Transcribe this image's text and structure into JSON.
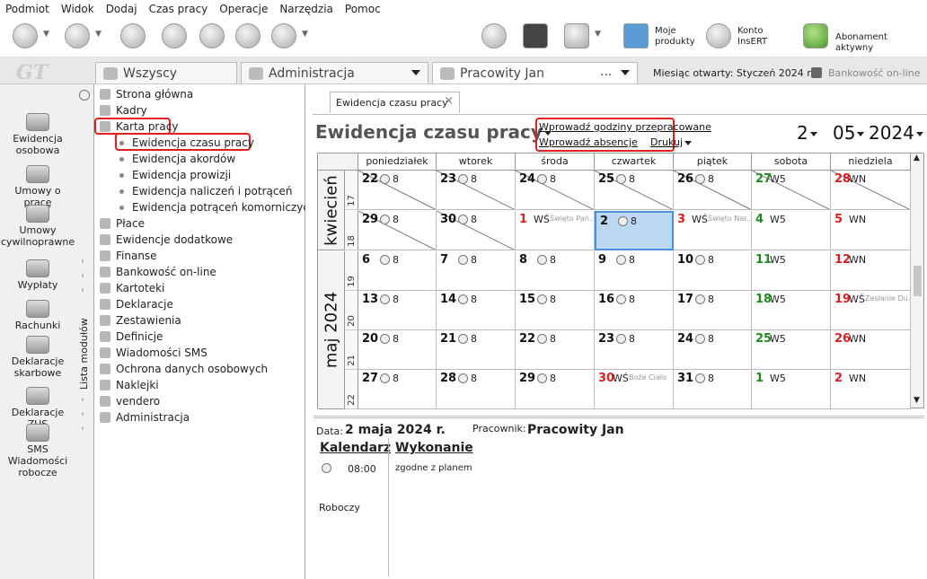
{
  "menu": [
    "Podmiot",
    "Widok",
    "Dodaj",
    "Czas pracy",
    "Operacje",
    "Narzędzia",
    "Pomoc"
  ],
  "toolbar": {
    "moje_produkty": [
      "Moje",
      "produkty"
    ],
    "konto_insert": [
      "Konto",
      "InsERT"
    ],
    "abonament": "Abonament aktywny"
  },
  "tabs": {
    "wszyscy": "Wszyscy",
    "administracja": "Administracja",
    "pracownik": "Pracowity Jan",
    "pracownik_more": "...",
    "miesiac_label": "Miesiąc otwarty:",
    "miesiac_value": "Styczeń 2024 r.",
    "bankowosc": "Bankowość on-line"
  },
  "sidebar": [
    {
      "label": [
        "Ewidencja",
        "osobowa"
      ],
      "icon": "people-icon"
    },
    {
      "label": [
        "Umowy o pracę"
      ],
      "icon": "handshake-icon"
    },
    {
      "label": [
        "Umowy",
        "cywilnoprawne"
      ],
      "icon": "contract-icon"
    },
    {
      "label": [
        "Wypłaty"
      ],
      "icon": "money-icon"
    },
    {
      "label": [
        "Rachunki"
      ],
      "icon": "bill-icon"
    },
    {
      "label": [
        "Deklaracje",
        "skarbowe"
      ],
      "icon": "tax-icon"
    },
    {
      "label": [
        "Deklaracje ZUS"
      ],
      "icon": "zus-icon"
    },
    {
      "label": [
        "SMS",
        "Wiadomości",
        "robocze"
      ],
      "icon": "sms-icon"
    }
  ],
  "lista_modulow": "Lista modułów",
  "tree": [
    {
      "label": "Strona główna",
      "level": 0
    },
    {
      "label": "Kadry",
      "level": 0
    },
    {
      "label": "Karta pracy",
      "level": 0
    },
    {
      "label": "Ewidencja czasu pracy",
      "level": 1
    },
    {
      "label": "Ewidencja akordów",
      "level": 1
    },
    {
      "label": "Ewidencja prowizji",
      "level": 1
    },
    {
      "label": "Ewidencja naliczeń i potrąceń",
      "level": 1
    },
    {
      "label": "Ewidencja potrąceń komorniczych",
      "level": 1
    },
    {
      "label": "Płace",
      "level": 0
    },
    {
      "label": "Ewidencje dodatkowe",
      "level": 0
    },
    {
      "label": "Finanse",
      "level": 0
    },
    {
      "label": "Bankowość on-line",
      "level": 0
    },
    {
      "label": "Kartoteki",
      "level": 0
    },
    {
      "label": "Deklaracje",
      "level": 0
    },
    {
      "label": "Zestawienia",
      "level": 0
    },
    {
      "label": "Definicje",
      "level": 0
    },
    {
      "label": "Wiadomości SMS",
      "level": 0
    },
    {
      "label": "Ochrona danych osobowych",
      "level": 0
    },
    {
      "label": "Naklejki",
      "level": 0
    },
    {
      "label": "vendero",
      "level": 0
    },
    {
      "label": "Administracja",
      "level": 0
    }
  ],
  "content": {
    "tab_title": "Ewidencja czasu pracy",
    "title": "Ewidencja czasu pracy",
    "link_godziny": "Wprowadź godziny przepracowane",
    "link_absencje": "Wprowadź absencje",
    "drukuj": "Drukuj",
    "day": "2",
    "month": "05",
    "year": "2024"
  },
  "calendar": {
    "weekdays": [
      "poniedziałek",
      "wtorek",
      "środa",
      "czwartek",
      "piątek",
      "sobota",
      "niedziela"
    ],
    "months": [
      {
        "name": "kwiecień",
        "rows": 2
      },
      {
        "name": "maj 2024",
        "rows": 4
      }
    ],
    "weeks": [
      "17",
      "18",
      "19",
      "20",
      "21",
      "22"
    ],
    "rows": [
      [
        {
          "d": "22",
          "c": "black",
          "t": "8",
          "diag": true
        },
        {
          "d": "23",
          "c": "black",
          "t": "8",
          "diag": true
        },
        {
          "d": "24",
          "c": "black",
          "t": "8",
          "diag": true
        },
        {
          "d": "25",
          "c": "black",
          "t": "8",
          "diag": true
        },
        {
          "d": "26",
          "c": "black",
          "t": "8",
          "diag": true
        },
        {
          "d": "27",
          "c": "green",
          "code": "W5",
          "diag": true
        },
        {
          "d": "28",
          "c": "red",
          "code": "WN",
          "diag": true
        }
      ],
      [
        {
          "d": "29",
          "c": "black",
          "t": "8",
          "diag": true
        },
        {
          "d": "30",
          "c": "black",
          "t": "8",
          "diag": true
        },
        {
          "d": "1",
          "c": "red",
          "code": "WŚ",
          "hol": "Święto Pań..."
        },
        {
          "d": "2",
          "c": "black",
          "t": "8",
          "sel": true
        },
        {
          "d": "3",
          "c": "red",
          "code": "WŚ",
          "hol": "Święto Nar..."
        },
        {
          "d": "4",
          "c": "green",
          "code": "W5"
        },
        {
          "d": "5",
          "c": "red",
          "code": "WN"
        }
      ],
      [
        {
          "d": "6",
          "c": "black",
          "t": "8"
        },
        {
          "d": "7",
          "c": "black",
          "t": "8"
        },
        {
          "d": "8",
          "c": "black",
          "t": "8"
        },
        {
          "d": "9",
          "c": "black",
          "t": "8"
        },
        {
          "d": "10",
          "c": "black",
          "t": "8"
        },
        {
          "d": "11",
          "c": "green",
          "code": "W5"
        },
        {
          "d": "12",
          "c": "red",
          "code": "WN"
        }
      ],
      [
        {
          "d": "13",
          "c": "black",
          "t": "8"
        },
        {
          "d": "14",
          "c": "black",
          "t": "8"
        },
        {
          "d": "15",
          "c": "black",
          "t": "8"
        },
        {
          "d": "16",
          "c": "black",
          "t": "8"
        },
        {
          "d": "17",
          "c": "black",
          "t": "8"
        },
        {
          "d": "18",
          "c": "green",
          "code": "W5"
        },
        {
          "d": "19",
          "c": "red",
          "code": "WŚ",
          "hol": "Zesłanie Du..."
        }
      ],
      [
        {
          "d": "20",
          "c": "black",
          "t": "8"
        },
        {
          "d": "21",
          "c": "black",
          "t": "8"
        },
        {
          "d": "22",
          "c": "black",
          "t": "8"
        },
        {
          "d": "23",
          "c": "black",
          "t": "8"
        },
        {
          "d": "24",
          "c": "black",
          "t": "8"
        },
        {
          "d": "25",
          "c": "green",
          "code": "W5"
        },
        {
          "d": "26",
          "c": "red",
          "code": "WN"
        }
      ],
      [
        {
          "d": "27",
          "c": "black",
          "t": "8"
        },
        {
          "d": "28",
          "c": "black",
          "t": "8"
        },
        {
          "d": "29",
          "c": "black",
          "t": "8"
        },
        {
          "d": "30",
          "c": "red",
          "code": "WŚ",
          "hol": "Boże Ciało"
        },
        {
          "d": "31",
          "c": "black",
          "t": "8"
        },
        {
          "d": "1",
          "c": "green",
          "code": "W5"
        },
        {
          "d": "2",
          "c": "red",
          "code": "WN"
        }
      ]
    ]
  },
  "detail": {
    "data_label": "Data:",
    "data_value": "2 maja 2024 r.",
    "pracownik_label": "Pracownik:",
    "pracownik_value": "Pracowity Jan",
    "kalendarz": "Kalendarz",
    "wykonanie": "Wykonanie",
    "time": "08:00",
    "wykonanie_text": "zgodne z planem",
    "roboczy": "Roboczy"
  },
  "colors": {
    "red": "#d42121",
    "green": "#1e8a1e",
    "selected": "#bcd7f1",
    "highlight": "#e02020"
  }
}
